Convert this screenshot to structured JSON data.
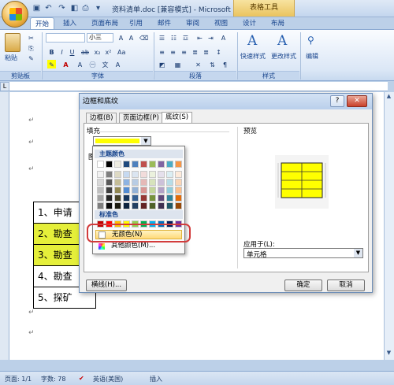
{
  "window": {
    "title": "资料清单.doc [兼容模式] - Microsoft ...",
    "contextual_tab": "表格工具"
  },
  "tabs": [
    "开始",
    "插入",
    "页面布局",
    "引用",
    "邮件",
    "审阅",
    "视图",
    "设计",
    "布局"
  ],
  "ribbon": {
    "paste_label": "粘贴",
    "font_size": "小三",
    "group_clipboard": "剪贴板",
    "group_font": "字体",
    "group_paragraph": "段落",
    "group_styles": "样式",
    "quick_styles": "快速样式",
    "change_styles": "更改样式",
    "editing": "编辑"
  },
  "document": {
    "rows": [
      "1、申请",
      "2、勘查",
      "3、勘查",
      "4、勘查",
      "5、探矿"
    ],
    "highlighted_rows": [
      1,
      2
    ]
  },
  "status": {
    "page": "页面: 1/1",
    "words": "字数: 78",
    "language": "英语(美国)",
    "mode": "插入"
  },
  "dialog": {
    "title": "边框和底纹",
    "tabs": [
      "边框(B)",
      "页面边框(P)",
      "底纹(S)"
    ],
    "fill_label": "填充",
    "pattern_label": "图",
    "preview_label": "预览",
    "apply_to_label": "应用于(L):",
    "apply_to_value": "单元格",
    "hline_button": "横线(H)...",
    "ok": "确定",
    "cancel": "取消",
    "fill_color": "#ffff00"
  },
  "color_dropdown": {
    "theme_header": "主题颜色",
    "standard_header": "标准色",
    "no_color": "无颜色(N)",
    "more_colors": "其他颜色(M)...",
    "theme_top": [
      "#ffffff",
      "#000000",
      "#eeece1",
      "#1f497d",
      "#4f81bd",
      "#c0504d",
      "#9bbb59",
      "#8064a2",
      "#4bacc6",
      "#f79646"
    ],
    "theme_shades": [
      [
        "#f2f2f2",
        "#7f7f7f",
        "#ddd9c3",
        "#c6d9f0",
        "#dbe5f1",
        "#f2dcdb",
        "#ebf1dd",
        "#e5e0ec",
        "#dbeef3",
        "#fdeada"
      ],
      [
        "#d8d8d8",
        "#595959",
        "#c4bd97",
        "#8db3e2",
        "#b8cce4",
        "#e5b9b7",
        "#d7e3bc",
        "#ccc1d9",
        "#b7dde8",
        "#fbd5b5"
      ],
      [
        "#bfbfbf",
        "#3f3f3f",
        "#938953",
        "#548dd4",
        "#95b3d7",
        "#d99694",
        "#c3d69b",
        "#b2a2c7",
        "#92cddc",
        "#fac08f"
      ],
      [
        "#a5a5a5",
        "#262626",
        "#494429",
        "#17365d",
        "#366092",
        "#953734",
        "#76923c",
        "#5f497a",
        "#31859b",
        "#e36c09"
      ],
      [
        "#7f7f7f",
        "#0c0c0c",
        "#1d1b10",
        "#0f243e",
        "#244061",
        "#632423",
        "#4f6128",
        "#3f3151",
        "#205867",
        "#974806"
      ]
    ],
    "standard": [
      "#c00000",
      "#ff0000",
      "#ffc000",
      "#ffff00",
      "#92d050",
      "#00b050",
      "#00b0f0",
      "#0070c0",
      "#002060",
      "#7030a0"
    ]
  }
}
